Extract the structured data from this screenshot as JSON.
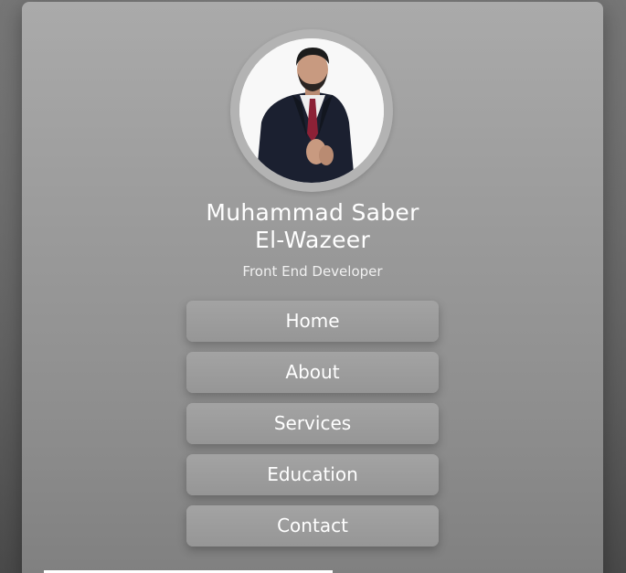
{
  "profile": {
    "name_line1": "Muhammad Saber",
    "name_line2": "El-Wazeer",
    "title": "Front End Developer",
    "avatar_icon": "profile-photo"
  },
  "nav": {
    "items": [
      {
        "label": "Home"
      },
      {
        "label": "About"
      },
      {
        "label": "Services"
      },
      {
        "label": "Education"
      },
      {
        "label": "Contact"
      }
    ]
  },
  "colors": {
    "card_top": "#aaaaaa",
    "card_bottom": "#7f7f7f",
    "button": "#9d9d9d",
    "text": "#ffffff"
  }
}
